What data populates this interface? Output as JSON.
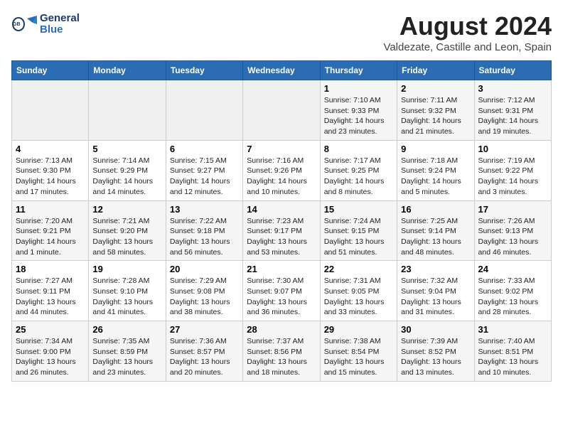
{
  "logo": {
    "line1": "General",
    "line2": "Blue"
  },
  "title": "August 2024",
  "subtitle": "Valdezate, Castille and Leon, Spain",
  "weekdays": [
    "Sunday",
    "Monday",
    "Tuesday",
    "Wednesday",
    "Thursday",
    "Friday",
    "Saturday"
  ],
  "weeks": [
    [
      {
        "day": "",
        "info": ""
      },
      {
        "day": "",
        "info": ""
      },
      {
        "day": "",
        "info": ""
      },
      {
        "day": "",
        "info": ""
      },
      {
        "day": "1",
        "info": "Sunrise: 7:10 AM\nSunset: 9:33 PM\nDaylight: 14 hours\nand 23 minutes."
      },
      {
        "day": "2",
        "info": "Sunrise: 7:11 AM\nSunset: 9:32 PM\nDaylight: 14 hours\nand 21 minutes."
      },
      {
        "day": "3",
        "info": "Sunrise: 7:12 AM\nSunset: 9:31 PM\nDaylight: 14 hours\nand 19 minutes."
      }
    ],
    [
      {
        "day": "4",
        "info": "Sunrise: 7:13 AM\nSunset: 9:30 PM\nDaylight: 14 hours\nand 17 minutes."
      },
      {
        "day": "5",
        "info": "Sunrise: 7:14 AM\nSunset: 9:29 PM\nDaylight: 14 hours\nand 14 minutes."
      },
      {
        "day": "6",
        "info": "Sunrise: 7:15 AM\nSunset: 9:27 PM\nDaylight: 14 hours\nand 12 minutes."
      },
      {
        "day": "7",
        "info": "Sunrise: 7:16 AM\nSunset: 9:26 PM\nDaylight: 14 hours\nand 10 minutes."
      },
      {
        "day": "8",
        "info": "Sunrise: 7:17 AM\nSunset: 9:25 PM\nDaylight: 14 hours\nand 8 minutes."
      },
      {
        "day": "9",
        "info": "Sunrise: 7:18 AM\nSunset: 9:24 PM\nDaylight: 14 hours\nand 5 minutes."
      },
      {
        "day": "10",
        "info": "Sunrise: 7:19 AM\nSunset: 9:22 PM\nDaylight: 14 hours\nand 3 minutes."
      }
    ],
    [
      {
        "day": "11",
        "info": "Sunrise: 7:20 AM\nSunset: 9:21 PM\nDaylight: 14 hours\nand 1 minute."
      },
      {
        "day": "12",
        "info": "Sunrise: 7:21 AM\nSunset: 9:20 PM\nDaylight: 13 hours\nand 58 minutes."
      },
      {
        "day": "13",
        "info": "Sunrise: 7:22 AM\nSunset: 9:18 PM\nDaylight: 13 hours\nand 56 minutes."
      },
      {
        "day": "14",
        "info": "Sunrise: 7:23 AM\nSunset: 9:17 PM\nDaylight: 13 hours\nand 53 minutes."
      },
      {
        "day": "15",
        "info": "Sunrise: 7:24 AM\nSunset: 9:15 PM\nDaylight: 13 hours\nand 51 minutes."
      },
      {
        "day": "16",
        "info": "Sunrise: 7:25 AM\nSunset: 9:14 PM\nDaylight: 13 hours\nand 48 minutes."
      },
      {
        "day": "17",
        "info": "Sunrise: 7:26 AM\nSunset: 9:13 PM\nDaylight: 13 hours\nand 46 minutes."
      }
    ],
    [
      {
        "day": "18",
        "info": "Sunrise: 7:27 AM\nSunset: 9:11 PM\nDaylight: 13 hours\nand 44 minutes."
      },
      {
        "day": "19",
        "info": "Sunrise: 7:28 AM\nSunset: 9:10 PM\nDaylight: 13 hours\nand 41 minutes."
      },
      {
        "day": "20",
        "info": "Sunrise: 7:29 AM\nSunset: 9:08 PM\nDaylight: 13 hours\nand 38 minutes."
      },
      {
        "day": "21",
        "info": "Sunrise: 7:30 AM\nSunset: 9:07 PM\nDaylight: 13 hours\nand 36 minutes."
      },
      {
        "day": "22",
        "info": "Sunrise: 7:31 AM\nSunset: 9:05 PM\nDaylight: 13 hours\nand 33 minutes."
      },
      {
        "day": "23",
        "info": "Sunrise: 7:32 AM\nSunset: 9:04 PM\nDaylight: 13 hours\nand 31 minutes."
      },
      {
        "day": "24",
        "info": "Sunrise: 7:33 AM\nSunset: 9:02 PM\nDaylight: 13 hours\nand 28 minutes."
      }
    ],
    [
      {
        "day": "25",
        "info": "Sunrise: 7:34 AM\nSunset: 9:00 PM\nDaylight: 13 hours\nand 26 minutes."
      },
      {
        "day": "26",
        "info": "Sunrise: 7:35 AM\nSunset: 8:59 PM\nDaylight: 13 hours\nand 23 minutes."
      },
      {
        "day": "27",
        "info": "Sunrise: 7:36 AM\nSunset: 8:57 PM\nDaylight: 13 hours\nand 20 minutes."
      },
      {
        "day": "28",
        "info": "Sunrise: 7:37 AM\nSunset: 8:56 PM\nDaylight: 13 hours\nand 18 minutes."
      },
      {
        "day": "29",
        "info": "Sunrise: 7:38 AM\nSunset: 8:54 PM\nDaylight: 13 hours\nand 15 minutes."
      },
      {
        "day": "30",
        "info": "Sunrise: 7:39 AM\nSunset: 8:52 PM\nDaylight: 13 hours\nand 13 minutes."
      },
      {
        "day": "31",
        "info": "Sunrise: 7:40 AM\nSunset: 8:51 PM\nDaylight: 13 hours\nand 10 minutes."
      }
    ]
  ]
}
